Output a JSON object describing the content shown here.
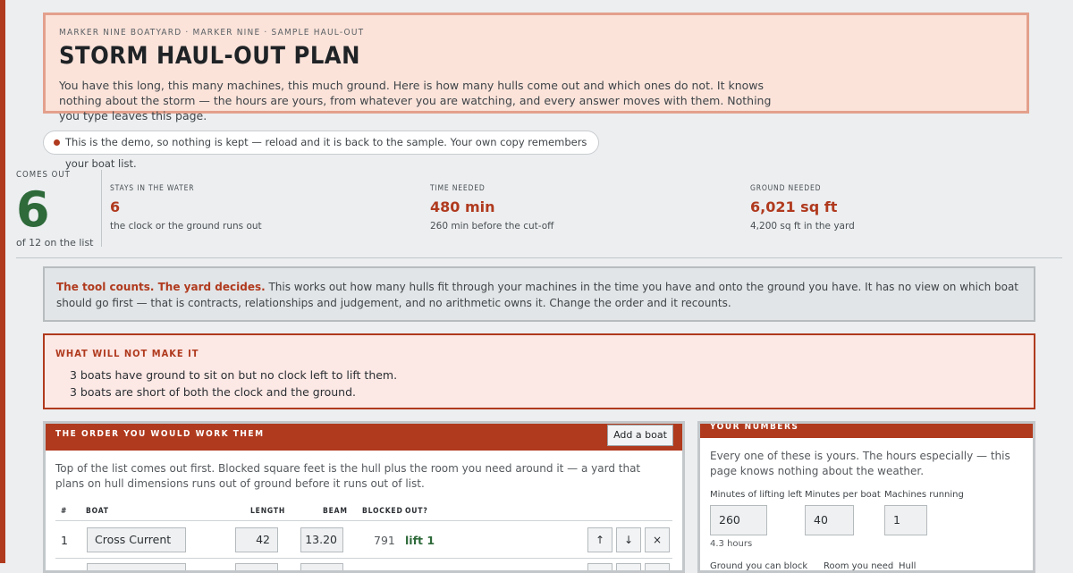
{
  "header": {
    "crumbs": "MARKER NINE BOATYARD · MARKER NINE · SAMPLE HAUL-OUT",
    "title": "STORM HAUL-OUT PLAN",
    "intro": "You have this long, this many machines, this much ground. Here is how many hulls come out and which ones do not. It knows nothing about the storm — the hours are yours, from whatever you are watching, and every answer moves with them. Nothing you type leaves this page."
  },
  "demo_notice": "This is the demo, so nothing is kept — reload and it is back to the sample. Your own copy remembers your boat list.",
  "summary": {
    "comes_out": {
      "label": "COMES OUT",
      "value": "6",
      "sub": "of 12 on the list"
    },
    "stays": {
      "label": "STAYS IN THE WATER",
      "value": "6",
      "sub": "the clock or the ground runs out"
    },
    "time": {
      "label": "TIME NEEDED",
      "value": "480 min",
      "sub": "260 min before the cut-off"
    },
    "ground": {
      "label": "GROUND NEEDED",
      "value": "6,021 sq ft",
      "sub": "4,200 sq ft in the yard"
    }
  },
  "note": {
    "lead": "The tool counts. The yard decides.",
    "body": " This works out how many hulls fit through your machines in the time you have and onto the ground you have. It has no view on which boat should go first — that is contracts, relationships and judgement, and no arithmetic owns it. Change the order and it recounts."
  },
  "warning": {
    "title": "WHAT WILL NOT MAKE IT",
    "lines": [
      "3 boats have ground to sit on but no clock left to lift them.",
      "3 boats are short of both the clock and the ground."
    ]
  },
  "order_panel": {
    "title": "THE ORDER YOU WOULD WORK THEM",
    "add_button": "Add a boat",
    "intro": "Top of the list comes out first. Blocked square feet is the hull plus the room you need around it — a yard that plans on hull dimensions runs out of ground before it runs out of list.",
    "columns": [
      "#",
      "BOAT",
      "LENGTH",
      "BEAM",
      "BLOCKED",
      "OUT?"
    ],
    "rows": [
      {
        "index": "1",
        "boat": "Cross Current",
        "length": "42",
        "beam": "13.20",
        "blocked": "791",
        "out": "lift 1"
      }
    ],
    "controls": {
      "up": "↑",
      "down": "↓",
      "remove": "×"
    }
  },
  "numbers_panel": {
    "title": "YOUR NUMBERS",
    "intro": "Every one of these is yours. The hours especially — this page knows nothing about the weather.",
    "fields": [
      {
        "label": "Minutes of lifting left",
        "value": "260"
      },
      {
        "label": "Minutes per boat",
        "value": "40"
      },
      {
        "label": "Machines running",
        "value": "1"
      }
    ],
    "hint": "4.3 hours",
    "more_labels": [
      "Ground you can block",
      "Room you need",
      "Hull"
    ]
  },
  "colors": {
    "accent": "#b03a1e",
    "success": "#2e6a3a",
    "hero_bg": "#fbe3da"
  }
}
